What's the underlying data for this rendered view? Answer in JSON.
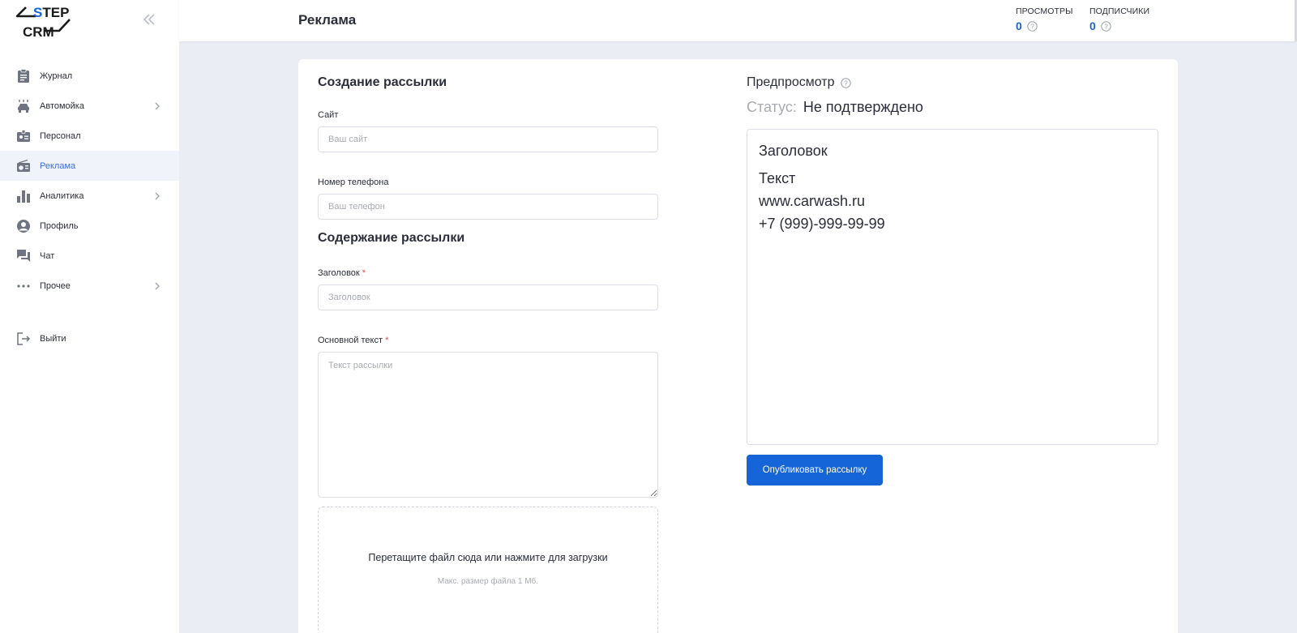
{
  "app": {
    "logo_top": "STEP",
    "logo_bottom": "CRM"
  },
  "sidebar": {
    "items": [
      {
        "label": "Журнал",
        "icon": "clipboard-icon",
        "has_submenu": false,
        "active": false
      },
      {
        "label": "Автомойка",
        "icon": "car-wash-icon",
        "has_submenu": true,
        "active": false
      },
      {
        "label": "Персонал",
        "icon": "badge-icon",
        "has_submenu": false,
        "active": false
      },
      {
        "label": "Реклама",
        "icon": "radio-icon",
        "has_submenu": false,
        "active": true
      },
      {
        "label": "Аналитика",
        "icon": "bar-chart-icon",
        "has_submenu": true,
        "active": false
      },
      {
        "label": "Профиль",
        "icon": "user-circle-icon",
        "has_submenu": false,
        "active": false
      },
      {
        "label": "Чат",
        "icon": "chat-icon",
        "has_submenu": false,
        "active": false
      },
      {
        "label": "Прочее",
        "icon": "more-dots-icon",
        "has_submenu": true,
        "active": false
      }
    ],
    "logout_label": "Выйти"
  },
  "header": {
    "title": "Реклама",
    "stats": [
      {
        "label": "ПРОСМОТРЫ",
        "value": "0"
      },
      {
        "label": "ПОДПИСЧИКИ",
        "value": "0"
      }
    ]
  },
  "form": {
    "create_title": "Создание рассылки",
    "site_label": "Сайт",
    "site_placeholder": "Ваш сайт",
    "phone_label": "Номер телефона",
    "phone_placeholder": "Ваш телефон",
    "content_title": "Содержание рассылки",
    "heading_label": "Заголовок",
    "heading_placeholder": "Заголовок",
    "body_label": "Основной текст",
    "body_placeholder": "Текст рассылки",
    "required_mark": "*",
    "upload_title": "Перетащите файл сюда или нажмите для загрузки",
    "upload_hint": "Макс. размер файла 1 Мб."
  },
  "preview": {
    "title": "Предпросмотр",
    "status_label": "Статус:",
    "status_value": "Не подтверждено",
    "heading": "Заголовок",
    "text": "Текст",
    "site": "www.carwash.ru",
    "phone": "+7 (999)-999-99-99",
    "publish_label": "Опубликовать рассылку"
  },
  "colors": {
    "accent": "#1565d8",
    "active_nav": "#3f6fd6",
    "background": "#ebedf5",
    "required": "#e5484d"
  }
}
